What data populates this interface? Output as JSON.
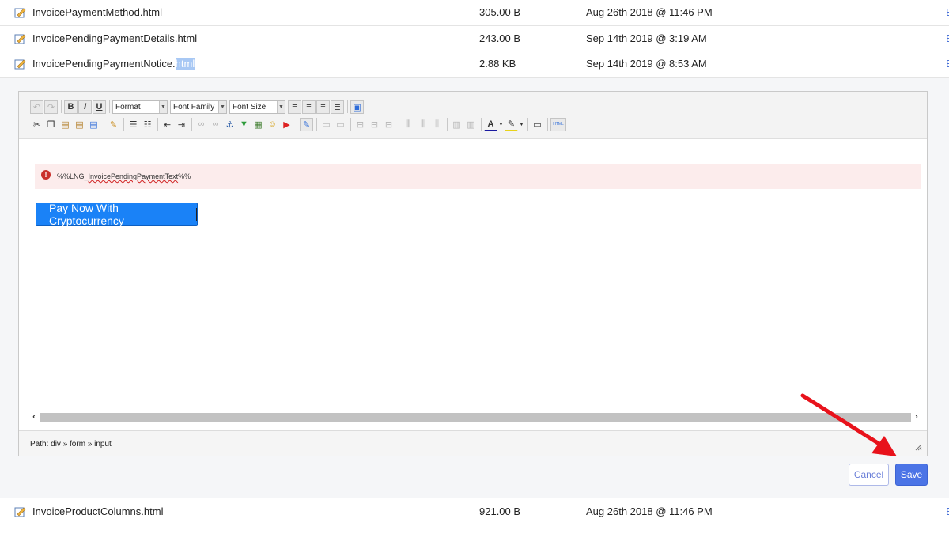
{
  "files_top": [
    {
      "name": "InvoicePaymentMethod.html",
      "size": "305.00 B",
      "date": "Aug 26th 2018 @ 11:46 PM",
      "edge": "E"
    },
    {
      "name": "InvoicePendingPaymentDetails.html",
      "size": "243.00 B",
      "date": "Sep 14th 2019 @ 3:19 AM",
      "edge": "E"
    },
    {
      "name_plain": "InvoicePendingPaymentNotice.",
      "name_selected": "html",
      "size": "2.88 KB",
      "date": "Sep 14th 2019 @ 8:53 AM",
      "edge": "E"
    }
  ],
  "files_bottom": [
    {
      "name": "InvoiceProductColumns.html",
      "size": "921.00 B",
      "date": "Aug 26th 2018 @ 11:46 PM",
      "edge": "E"
    }
  ],
  "toolbar": {
    "format_label": "Format",
    "font_family_label": "Font Family",
    "font_size_label": "Font Size",
    "bold": "B",
    "italic": "I",
    "underline": "U",
    "html_label": "HTML"
  },
  "content": {
    "alert_prefix": "%%LNG_",
    "alert_underlined": "InvoicePendingPaymentText",
    "alert_suffix": "%%",
    "pay_button": "Pay Now With Cryptocurrency"
  },
  "statusbar": {
    "path": "Path: div » form » input"
  },
  "actions": {
    "cancel": "Cancel",
    "save": "Save"
  },
  "colors": {
    "save_button": "#4b74e6",
    "pay_button": "#1a82f7",
    "alert_bg": "#fcecec",
    "annotation_arrow": "#e8121b"
  }
}
